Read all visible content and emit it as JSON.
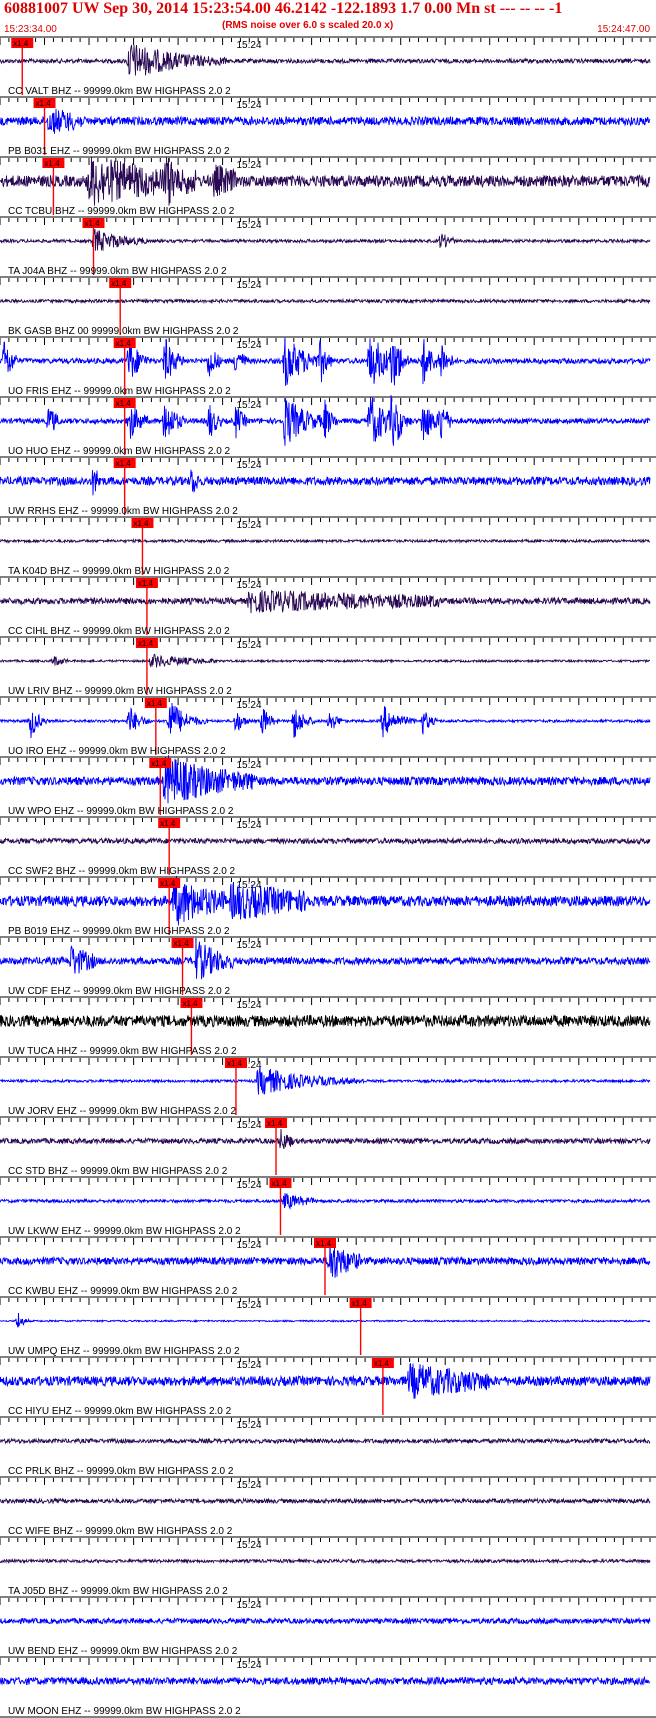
{
  "header": {
    "title": "60881007 UW Sep 30, 2014 15:23:54.00   46.2142 -122.1893  1.7 0.00 Mn st --- -- --  -1",
    "subtitle": "(RMS noise over 6.0 s scaled 20.0 x)",
    "start_time": "15:23:34.00",
    "end_time": "15:24:47.00"
  },
  "colors": {
    "title": "#e00000",
    "pick_marker": "#ff0000",
    "trace_blue": "#0000ff",
    "trace_purple": "#2a0a55",
    "trace_black": "#000000",
    "label": "#000000"
  },
  "chart_data": {
    "type": "line",
    "title": "60881007 UW Sep 30, 2014 15:23:54.00   46.2142 -122.1893  1.7 0.00 Mn st --- -- --  -1",
    "xlabel": "",
    "ylabel": "",
    "x_range_seconds": [
      0,
      73
    ],
    "x_tick_spacing_s": 1,
    "minute_label": "15:24",
    "minute_mark_s": 26,
    "pick_label": "x1.4",
    "grid": false,
    "stations": [
      {
        "label": "CC VALT BHZ -- 99999.0km BW  HIGHPASS  2.0  2",
        "color": "#2a0a55",
        "pick_s": 2.5,
        "noise": 0.08,
        "bursts": [
          {
            "t": 14.5,
            "amp": 0.7,
            "dur": 5
          }
        ]
      },
      {
        "label": "PB B031 EHZ -- 99999.0km BW  HIGHPASS  2.0  2",
        "color": "#0000ff",
        "pick_s": 5.0,
        "noise": 0.16,
        "bursts": [
          {
            "t": 5.5,
            "amp": 0.4,
            "dur": 4
          }
        ]
      },
      {
        "label": "CC TCBU BHZ -- 99999.0km BW  HIGHPASS  2.0  2",
        "color": "#2a0a55",
        "pick_s": 6.0,
        "noise": 0.22,
        "bursts": [
          {
            "t": 10,
            "amp": 0.85,
            "dur": 8
          },
          {
            "t": 18.5,
            "amp": 0.7,
            "dur": 3
          },
          {
            "t": 24,
            "amp": 0.5,
            "dur": 3
          }
        ]
      },
      {
        "label": "TA J04A BHZ -- 99999.0km BW  HIGHPASS  2.0  2",
        "color": "#2a0a55",
        "pick_s": 10.5,
        "noise": 0.06,
        "bursts": [
          {
            "t": 10.5,
            "amp": 0.45,
            "dur": 3
          },
          {
            "t": 49.5,
            "amp": 0.3,
            "dur": 1
          }
        ]
      },
      {
        "label": "BK GASB BHZ 00 99999.0km BW  HIGHPASS  2.0  2",
        "color": "#2a0a55",
        "pick_s": 13.5,
        "noise": 0.06,
        "bursts": []
      },
      {
        "label": "UO FRIS EHZ -- 99999.0km BW  HIGHPASS  2.0  2",
        "color": "#0000ff",
        "pick_s": 14.0,
        "noise": 0.1,
        "bursts": [
          {
            "t": 0.5,
            "amp": 0.9,
            "dur": 0.7
          },
          {
            "t": 14.5,
            "amp": 0.9,
            "dur": 1
          },
          {
            "t": 18.5,
            "amp": 0.9,
            "dur": 1
          },
          {
            "t": 23.5,
            "amp": 0.7,
            "dur": 0.7
          },
          {
            "t": 26.5,
            "amp": 0.6,
            "dur": 0.7
          },
          {
            "t": 32,
            "amp": 1.0,
            "dur": 2
          },
          {
            "t": 36,
            "amp": 0.7,
            "dur": 0.7
          },
          {
            "t": 41.5,
            "amp": 1.0,
            "dur": 2
          },
          {
            "t": 44,
            "amp": 0.9,
            "dur": 1
          },
          {
            "t": 47.5,
            "amp": 0.9,
            "dur": 1
          },
          {
            "t": 49.5,
            "amp": 0.8,
            "dur": 0.7
          }
        ]
      },
      {
        "label": "UO HUO EHZ -- 99999.0km BW  HIGHPASS  2.0  2",
        "color": "#0000ff",
        "pick_s": 14.0,
        "noise": 0.1,
        "bursts": [
          {
            "t": 5.5,
            "amp": 0.6,
            "dur": 0.7
          },
          {
            "t": 14.5,
            "amp": 0.8,
            "dur": 1
          },
          {
            "t": 18.5,
            "amp": 0.9,
            "dur": 1
          },
          {
            "t": 23.5,
            "amp": 0.7,
            "dur": 0.7
          },
          {
            "t": 26.5,
            "amp": 0.6,
            "dur": 0.7
          },
          {
            "t": 32,
            "amp": 1.0,
            "dur": 2
          },
          {
            "t": 36.5,
            "amp": 0.7,
            "dur": 0.7
          },
          {
            "t": 41.5,
            "amp": 1.0,
            "dur": 2
          },
          {
            "t": 44,
            "amp": 0.9,
            "dur": 1
          },
          {
            "t": 47.5,
            "amp": 0.9,
            "dur": 1
          },
          {
            "t": 49.5,
            "amp": 0.8,
            "dur": 0.7
          }
        ]
      },
      {
        "label": "UW RRHS EHZ -- 99999.0km BW  HIGHPASS  2.0  2",
        "color": "#0000ff",
        "pick_s": 14.0,
        "noise": 0.16,
        "bursts": [
          {
            "t": 10.5,
            "amp": 0.5,
            "dur": 0.7
          },
          {
            "t": 21.5,
            "amp": 0.5,
            "dur": 0.7
          }
        ]
      },
      {
        "label": "TA K04D BHZ -- 99999.0km BW  HIGHPASS  2.0  2",
        "color": "#2a0a55",
        "pick_s": 16.0,
        "noise": 0.05,
        "bursts": []
      },
      {
        "label": "CC CIHL BHZ -- 99999.0km BW  HIGHPASS  2.0  2",
        "color": "#2a0a55",
        "pick_s": 16.5,
        "noise": 0.12,
        "bursts": [
          {
            "t": 28,
            "amp": 0.35,
            "dur": 20
          }
        ]
      },
      {
        "label": "UW LRIV BHZ -- 99999.0km BW  HIGHPASS  2.0  2",
        "color": "#2a0a55",
        "pick_s": 16.5,
        "noise": 0.04,
        "bursts": [
          {
            "t": 17,
            "amp": 0.25,
            "dur": 4
          },
          {
            "t": 6,
            "amp": 0.2,
            "dur": 1
          }
        ]
      },
      {
        "label": "UO IRO EHZ -- 99999.0km BW  HIGHPASS  2.0  2",
        "color": "#0000ff",
        "pick_s": 17.5,
        "noise": 0.05,
        "bursts": [
          {
            "t": 3.5,
            "amp": 0.7,
            "dur": 0.7
          },
          {
            "t": 14.5,
            "amp": 0.6,
            "dur": 1
          },
          {
            "t": 19,
            "amp": 0.9,
            "dur": 1.5
          },
          {
            "t": 26.5,
            "amp": 0.5,
            "dur": 0.7
          },
          {
            "t": 29.5,
            "amp": 0.6,
            "dur": 0.7
          },
          {
            "t": 33,
            "amp": 0.7,
            "dur": 1
          },
          {
            "t": 37,
            "amp": 0.5,
            "dur": 0.7
          },
          {
            "t": 43,
            "amp": 0.6,
            "dur": 1.5
          },
          {
            "t": 47.5,
            "amp": 0.5,
            "dur": 0.7
          }
        ]
      },
      {
        "label": "UW WPO EHZ -- 99999.0km BW  HIGHPASS  2.0  2",
        "color": "#0000ff",
        "pick_s": 18.0,
        "noise": 0.16,
        "bursts": [
          {
            "t": 18.5,
            "amp": 0.9,
            "dur": 6
          }
        ]
      },
      {
        "label": "CC SWF2 BHZ -- 99999.0km BW  HIGHPASS  2.0  2",
        "color": "#2a0a55",
        "pick_s": 19.0,
        "noise": 0.1,
        "bursts": []
      },
      {
        "label": "PB B019 EHZ -- 99999.0km BW  HIGHPASS  2.0  2",
        "color": "#0000ff",
        "pick_s": 19.0,
        "noise": 0.2,
        "bursts": [
          {
            "t": 19.5,
            "amp": 0.85,
            "dur": 4
          },
          {
            "t": 26,
            "amp": 0.6,
            "dur": 8
          }
        ]
      },
      {
        "label": "UW CDF EHZ -- 99999.0km BW  HIGHPASS  2.0  2",
        "color": "#0000ff",
        "pick_s": 20.5,
        "noise": 0.14,
        "bursts": [
          {
            "t": 8,
            "amp": 0.55,
            "dur": 2
          },
          {
            "t": 22,
            "amp": 0.75,
            "dur": 2.5
          }
        ]
      },
      {
        "label": "UW TUCA HHZ -- 99999.0km BW  HIGHPASS  2.0  2",
        "color": "#000000",
        "pick_s": 21.5,
        "noise": 0.22,
        "bursts": []
      },
      {
        "label": "UW JORV EHZ -- 99999.0km BW  HIGHPASS  2.0  2",
        "color": "#0000ff",
        "pick_s": 26.5,
        "noise": 0.05,
        "bursts": [
          {
            "t": 29,
            "amp": 0.55,
            "dur": 5
          }
        ]
      },
      {
        "label": "CC STD BHZ -- 99999.0km BW  HIGHPASS  2.0  2",
        "color": "#2a0a55",
        "pick_s": 31.0,
        "noise": 0.1,
        "bursts": [
          {
            "t": 31.5,
            "amp": 0.4,
            "dur": 1
          }
        ]
      },
      {
        "label": "UW LKWW EHZ -- 99999.0km BW  HIGHPASS  2.0  2",
        "color": "#0000ff",
        "pick_s": 31.5,
        "noise": 0.06,
        "bursts": [
          {
            "t": 32,
            "amp": 0.3,
            "dur": 2
          }
        ]
      },
      {
        "label": "CC KWBU EHZ -- 99999.0km BW  HIGHPASS  2.0  2",
        "color": "#0000ff",
        "pick_s": 36.5,
        "noise": 0.14,
        "bursts": [
          {
            "t": 37,
            "amp": 0.8,
            "dur": 2
          }
        ]
      },
      {
        "label": "UW UMPQ EHZ -- 99999.0km BW  HIGHPASS  2.0  2",
        "color": "#0000ff",
        "pick_s": 40.5,
        "noise": 0.03,
        "bursts": [
          {
            "t": 2,
            "amp": 0.4,
            "dur": 0.5
          }
        ]
      },
      {
        "label": "CC HIYU EHZ -- 99999.0km BW  HIGHPASS  2.0  2",
        "color": "#0000ff",
        "pick_s": 43.0,
        "noise": 0.18,
        "bursts": [
          {
            "t": 46,
            "amp": 0.55,
            "dur": 8
          }
        ]
      },
      {
        "label": "CC PRLK BHZ -- 99999.0km BW  HIGHPASS  2.0  2",
        "color": "#2a0a55",
        "pick_s": null,
        "noise": 0.08,
        "bursts": []
      },
      {
        "label": "CC WIFE BHZ -- 99999.0km BW  HIGHPASS  2.0  2",
        "color": "#2a0a55",
        "pick_s": null,
        "noise": 0.08,
        "bursts": []
      },
      {
        "label": "TA J05D BHZ -- 99999.0km BW  HIGHPASS  2.0  2",
        "color": "#2a0a55",
        "pick_s": null,
        "noise": 0.06,
        "bursts": []
      },
      {
        "label": "UW BEND EHZ -- 99999.0km BW  HIGHPASS  2.0  2",
        "color": "#0000ff",
        "pick_s": null,
        "noise": 0.1,
        "bursts": []
      },
      {
        "label": "UW MOON EHZ -- 99999.0km BW  HIGHPASS  2.0  2",
        "color": "#0000ff",
        "pick_s": null,
        "noise": 0.14,
        "bursts": []
      }
    ]
  }
}
